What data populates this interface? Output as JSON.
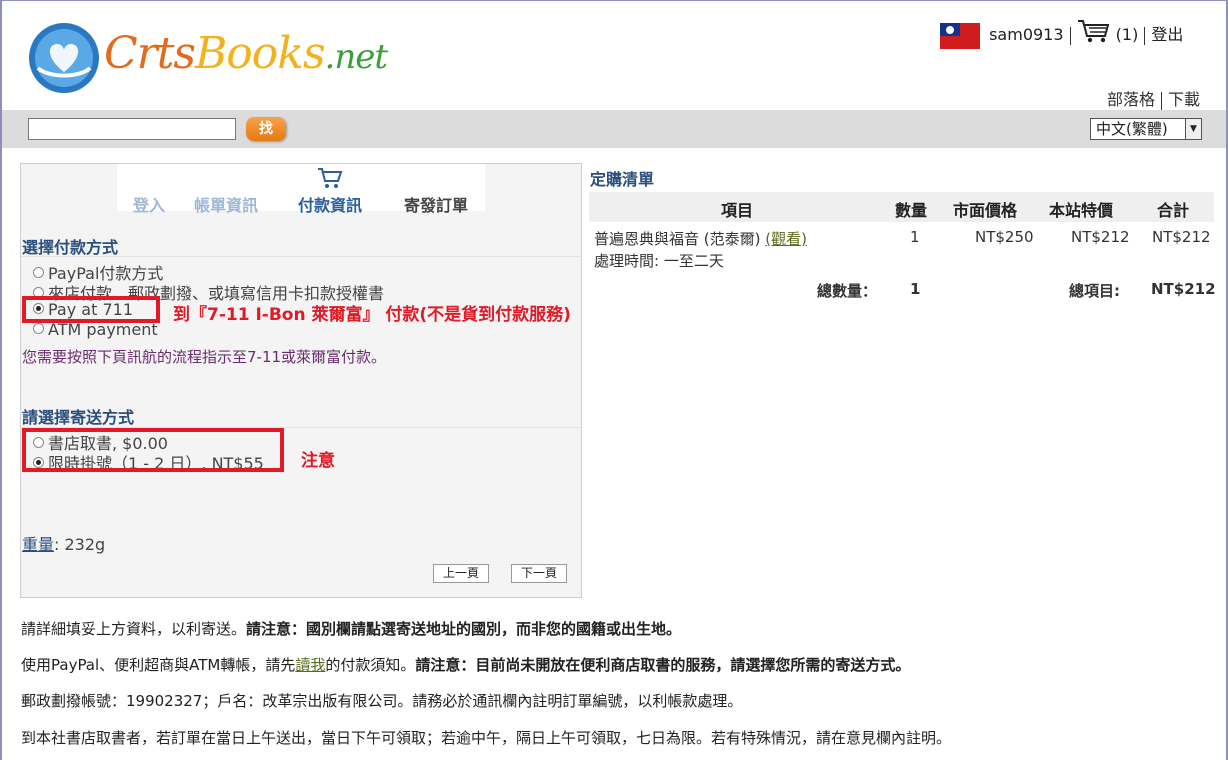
{
  "site": {
    "brand_crts": "Crts",
    "brand_books": "Books",
    "brand_net": ".net"
  },
  "user": {
    "username": "sam0913",
    "cart_count": "(1)",
    "logout": "登出"
  },
  "top_links": {
    "blog": "部落格",
    "download": "下載"
  },
  "search": {
    "value": "",
    "button": "找"
  },
  "language": {
    "selected": "中文(繁體)"
  },
  "steps": {
    "login": "登入",
    "account": "帳單資訊",
    "payment": "付款資訊",
    "submit": "寄發訂單"
  },
  "payment": {
    "title": "選擇付款方式",
    "options": [
      "PayPal付款方式",
      "來店付款、郵政劃撥、或填寫信用卡扣款授權書",
      "Pay at 711",
      "ATM payment"
    ],
    "selected_index": 2,
    "note": "您需要按照下頁訊航的流程指示至7-11或萊爾富付款。"
  },
  "shipping": {
    "title": "請選擇寄送方式",
    "options": [
      "書店取書, $0.00",
      "限時掛號（1 - 2 日）, NT$55"
    ],
    "selected_index": 1
  },
  "annotations": {
    "pay_note": "到『7-11 I-Bon 萊爾富』 付款(不是貨到付款服務)",
    "ship_note": "注意"
  },
  "weight": {
    "label": "重量",
    "value": ": 232g"
  },
  "pager": {
    "prev": "上一頁",
    "next": "下一頁"
  },
  "order": {
    "title": "定購清單",
    "headers": {
      "item": "項目",
      "qty": "數量",
      "market_price": "市面價格",
      "our_price": "本站特價",
      "total": "合計"
    },
    "rows": [
      {
        "name": "普遍恩典與福音 (范泰爾)",
        "view": "(觀看)",
        "processing": "處理時間: 一至二天",
        "qty": "1",
        "market_price": "NT$250",
        "our_price": "NT$212",
        "total": "NT$212"
      }
    ],
    "summary": {
      "qty_label": "總數量：",
      "qty": "1",
      "items_label": "總項目:",
      "items_total": "NT$212"
    }
  },
  "footer": {
    "line1_plain": "請詳細填妥上方資料，以利寄送。",
    "line1_bold": "請注意：國別欄請點選寄送地址的國別，而非您的國籍或出生地。",
    "line2_a": "使用PayPal、便利超商與ATM轉帳，請先",
    "line2_link": "讀我",
    "line2_b": "的付款須知。",
    "line2_bold": "請注意：目前尚未開放在便利商店取書的服務，請選擇您所需的寄送方式。",
    "line3": "郵政劃撥帳號：19902327；戶名：改革宗出版有限公司。請務必於通訊欄內註明訂單編號，以利帳款處理。",
    "line4": "到本社書店取書者，若訂單在當日上午送出，當日下午可領取；若逾中午，隔日上午可領取，七日為限。若有特殊情況，請在意見欄內註明。"
  }
}
